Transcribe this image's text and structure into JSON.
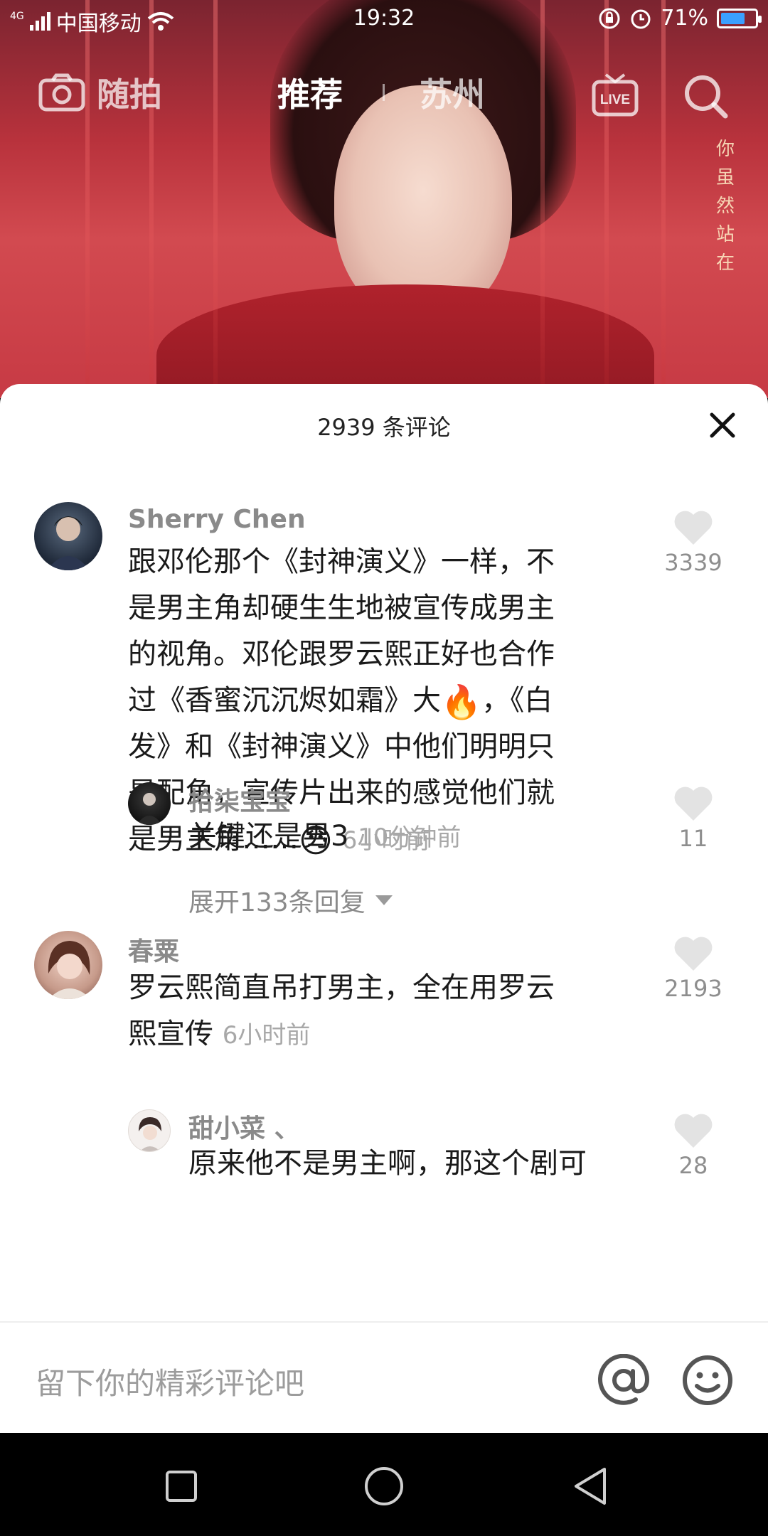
{
  "status_bar": {
    "network": "4G",
    "carrier": "中国移动",
    "time": "19:32",
    "battery": "71%",
    "battery_level": 0.71
  },
  "top_nav": {
    "camera_label": "随拍",
    "tab_recommend": "推荐",
    "tab_city": "苏州"
  },
  "video": {
    "overlay_text": "你 虽 然 站 在"
  },
  "sheet": {
    "title": "2939 条评论"
  },
  "comments": [
    {
      "author": "Sherry Chen",
      "lines": [
        "跟邓伦那个《封神演义》一样，不",
        "是男主角却硬生生地被宣传成男主",
        "的视角。邓伦跟罗云熙正好也合作",
        "过《香蜜沉沉烬如霜》大",
        "发》和《封神演义》中他们明明只",
        "是配角，宣传片出来的感觉他们就",
        "是男主角……"
      ],
      "line4_tail": "，《白",
      "emoji_fire": "🔥",
      "emoji_sweat": "😓",
      "time": "6小时前",
      "likes": "3339"
    },
    {
      "author": "拾柒宝宝",
      "text": "关键还是男3",
      "time": "10分钟前",
      "likes": "11",
      "expand_label": "展开133条回复"
    },
    {
      "author": "春粟",
      "lines": [
        "罗云熙简直吊打男主，全在用罗云",
        "熙宣传"
      ],
      "time": "6小时前",
      "likes": "2193"
    },
    {
      "author": "甜小菜 、",
      "text": "原来他不是男主啊，那这个剧可",
      "likes": "28"
    }
  ],
  "input_bar": {
    "placeholder": "留下你的精彩评论吧"
  },
  "colors": {
    "accent_battery": "#3aa0ff",
    "like_heart": "#e3e3e3",
    "secondary_text": "#8a8a8a"
  }
}
